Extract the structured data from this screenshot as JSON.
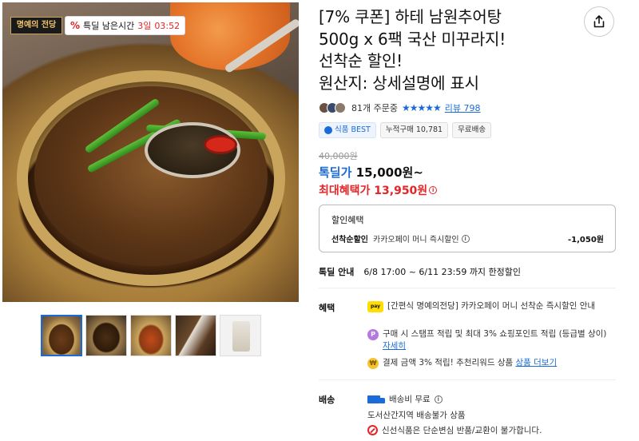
{
  "product": {
    "title_lines": [
      "[7% 쿠폰] 하테 남원추어탕",
      "500g x 6팩 국산 미꾸라지!",
      "선착순 할인!",
      "원산지: 상세설명에 표시"
    ],
    "brand_badge": "명예의 전당",
    "timer": {
      "icon": "%",
      "label": "특딜 남은시간",
      "days": "3일",
      "clock": "03:52"
    },
    "orders": "81개 주문중",
    "stars": "★★★★★",
    "reviews": "리뷰 798",
    "tags": [
      "식품 BEST",
      "누적구매 10,781",
      "무료배송"
    ],
    "original_price": "40,000원",
    "deal_price_label": "톡딜가",
    "deal_price": "15,000원~",
    "max_benefit": "최대혜택가 13,950원",
    "discount": {
      "header": "할인혜택",
      "name": "선착순할인",
      "desc": "카카오페이 머니 즉시할인",
      "amount": "-1,050원"
    },
    "deal_info": {
      "label": "톡딜 안내",
      "value": "6/8 17:00 ~ 6/11 23:59 까지 한정할인"
    },
    "benefits": {
      "label": "혜택",
      "items": [
        {
          "icon": "kakaopay-icon",
          "text": "[간편식 명예의전당] 카카오페이 머니 선착순 즉시할인 안내"
        },
        {
          "icon": "point-icon",
          "text": "구매 시 스탬프 적립 및 최대 3% 쇼핑포인트 적립 (등급별 상이)",
          "link": "자세히"
        },
        {
          "icon": "coin-icon",
          "text": "결제 금액 3% 적립! 추천리워드 상품",
          "link": "상품 더보기"
        }
      ]
    },
    "shipping": {
      "label": "배송",
      "fee": "배송비 무료",
      "note": "도서산간지역 배송불가 상품",
      "warning": "신선식품은 단순변심 반품/교환이 불가합니다."
    }
  },
  "colors": {
    "accent_blue": "#1a6bd8",
    "accent_red": "#e52528"
  }
}
